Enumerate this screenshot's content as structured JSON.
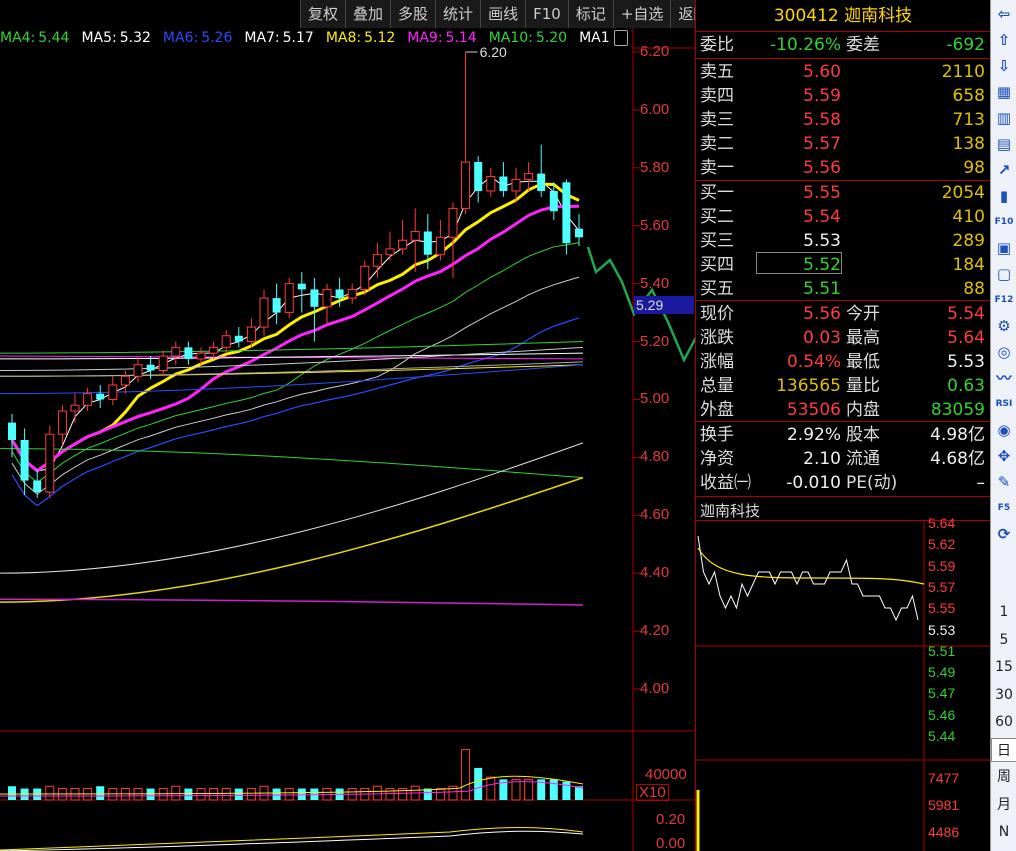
{
  "toolbar": {
    "buttons": [
      "复权",
      "叠加",
      "多股",
      "统计",
      "画线",
      "F10",
      "标记",
      "+自选",
      "返回"
    ]
  },
  "ma_legend": [
    {
      "label": "MA4:",
      "value": "5.44",
      "color": "#33d433"
    },
    {
      "label": "MA5:",
      "value": "5.32",
      "color": "#ffffff"
    },
    {
      "label": "MA6:",
      "value": "5.26",
      "color": "#2a4cff"
    },
    {
      "label": "MA7:",
      "value": "5.17",
      "color": "#ffffff"
    },
    {
      "label": "MA8:",
      "value": "5.12",
      "color": "#ffee00"
    },
    {
      "label": "MA9:",
      "value": "5.14",
      "color": "#ff22ff"
    },
    {
      "label": "MA10:",
      "value": "5.20",
      "color": "#33d433"
    },
    {
      "label": "MA1",
      "value": "",
      "color": "#ffffff"
    }
  ],
  "chart_data": {
    "type": "candlestick",
    "y_ticks": [
      "6.20",
      "6.00",
      "5.80",
      "5.60",
      "5.40",
      "5.20",
      "5.00",
      "4.80",
      "4.60",
      "4.40",
      "4.20",
      "4.00"
    ],
    "y_range": [
      3.95,
      6.25
    ],
    "high_marker": "6.20",
    "price_tag": "5.29",
    "volume_ticks": [
      "40000",
      "X10"
    ],
    "indicator_ticks": [
      "0.20",
      "0.00"
    ],
    "candles": [
      {
        "o": 4.92,
        "c": 4.86,
        "h": 4.95,
        "l": 4.8
      },
      {
        "o": 4.86,
        "c": 4.72,
        "h": 4.9,
        "l": 4.67
      },
      {
        "o": 4.72,
        "c": 4.68,
        "h": 4.76,
        "l": 4.66
      },
      {
        "o": 4.68,
        "c": 4.88,
        "h": 4.91,
        "l": 4.66
      },
      {
        "o": 4.88,
        "c": 4.96,
        "h": 4.98,
        "l": 4.84
      },
      {
        "o": 4.96,
        "c": 4.98,
        "h": 5.02,
        "l": 4.92
      },
      {
        "o": 4.98,
        "c": 5.02,
        "h": 5.04,
        "l": 4.96
      },
      {
        "o": 5.02,
        "c": 5.0,
        "h": 5.05,
        "l": 4.97
      },
      {
        "o": 5.0,
        "c": 5.05,
        "h": 5.08,
        "l": 4.98
      },
      {
        "o": 5.05,
        "c": 5.08,
        "h": 5.1,
        "l": 5.02
      },
      {
        "o": 5.08,
        "c": 5.12,
        "h": 5.15,
        "l": 5.06
      },
      {
        "o": 5.12,
        "c": 5.1,
        "h": 5.15,
        "l": 5.07
      },
      {
        "o": 5.1,
        "c": 5.15,
        "h": 5.17,
        "l": 5.08
      },
      {
        "o": 5.15,
        "c": 5.18,
        "h": 5.2,
        "l": 5.12
      },
      {
        "o": 5.18,
        "c": 5.14,
        "h": 5.2,
        "l": 5.12
      },
      {
        "o": 5.14,
        "c": 5.16,
        "h": 5.18,
        "l": 5.12
      },
      {
        "o": 5.16,
        "c": 5.18,
        "h": 5.2,
        "l": 5.14
      },
      {
        "o": 5.18,
        "c": 5.22,
        "h": 5.24,
        "l": 5.16
      },
      {
        "o": 5.22,
        "c": 5.2,
        "h": 5.25,
        "l": 5.18
      },
      {
        "o": 5.2,
        "c": 5.25,
        "h": 5.28,
        "l": 5.18
      },
      {
        "o": 5.25,
        "c": 5.35,
        "h": 5.38,
        "l": 5.22
      },
      {
        "o": 5.35,
        "c": 5.3,
        "h": 5.4,
        "l": 5.26
      },
      {
        "o": 5.3,
        "c": 5.4,
        "h": 5.42,
        "l": 5.28
      },
      {
        "o": 5.4,
        "c": 5.38,
        "h": 5.44,
        "l": 5.3
      },
      {
        "o": 5.38,
        "c": 5.32,
        "h": 5.42,
        "l": 5.2
      },
      {
        "o": 5.32,
        "c": 5.38,
        "h": 5.4,
        "l": 5.26
      },
      {
        "o": 5.38,
        "c": 5.35,
        "h": 5.42,
        "l": 5.32
      },
      {
        "o": 5.35,
        "c": 5.38,
        "h": 5.4,
        "l": 5.33
      },
      {
        "o": 5.38,
        "c": 5.46,
        "h": 5.48,
        "l": 5.36
      },
      {
        "o": 5.46,
        "c": 5.5,
        "h": 5.54,
        "l": 5.42
      },
      {
        "o": 5.5,
        "c": 5.52,
        "h": 5.58,
        "l": 5.48
      },
      {
        "o": 5.52,
        "c": 5.55,
        "h": 5.62,
        "l": 5.5
      },
      {
        "o": 5.55,
        "c": 5.58,
        "h": 5.66,
        "l": 5.44
      },
      {
        "o": 5.58,
        "c": 5.5,
        "h": 5.64,
        "l": 5.45
      },
      {
        "o": 5.5,
        "c": 5.56,
        "h": 5.62,
        "l": 5.48
      },
      {
        "o": 5.56,
        "c": 5.66,
        "h": 5.68,
        "l": 5.42
      },
      {
        "o": 5.66,
        "c": 5.82,
        "h": 6.2,
        "l": 5.64
      },
      {
        "o": 5.82,
        "c": 5.72,
        "h": 5.84,
        "l": 5.68
      },
      {
        "o": 5.72,
        "c": 5.77,
        "h": 5.8,
        "l": 5.7
      },
      {
        "o": 5.77,
        "c": 5.72,
        "h": 5.82,
        "l": 5.7
      },
      {
        "o": 5.72,
        "c": 5.76,
        "h": 5.8,
        "l": 5.68
      },
      {
        "o": 5.76,
        "c": 5.78,
        "h": 5.82,
        "l": 5.72
      },
      {
        "o": 5.78,
        "c": 5.72,
        "h": 5.88,
        "l": 5.7
      },
      {
        "o": 5.72,
        "c": 5.65,
        "h": 5.75,
        "l": 5.62
      },
      {
        "o": 5.75,
        "c": 5.54,
        "h": 5.76,
        "l": 5.5
      },
      {
        "o": 5.59,
        "c": 5.56,
        "h": 5.64,
        "l": 5.53
      }
    ],
    "volumes": [
      6,
      5,
      5,
      6,
      5,
      5,
      5,
      6,
      5,
      5,
      5,
      5,
      5,
      6,
      5,
      5,
      5,
      5,
      5,
      5,
      6,
      5,
      5,
      5,
      5,
      5,
      5,
      5,
      5,
      6,
      5,
      5,
      6,
      5,
      5,
      6,
      22,
      14,
      10,
      9,
      9,
      9,
      9,
      9,
      8,
      6
    ]
  },
  "quote": {
    "code": "300412",
    "name": "迦南科技",
    "weibi_label": "委比",
    "weibi": "-10.26%",
    "weicha_label": "委差",
    "weicha": "-692",
    "asks": [
      {
        "label": "卖五",
        "price": "5.60",
        "vol": "2110"
      },
      {
        "label": "卖四",
        "price": "5.59",
        "vol": "658"
      },
      {
        "label": "卖三",
        "price": "5.58",
        "vol": "713"
      },
      {
        "label": "卖二",
        "price": "5.57",
        "vol": "138"
      },
      {
        "label": "卖一",
        "price": "5.56",
        "vol": "98"
      }
    ],
    "bids": [
      {
        "label": "买一",
        "price": "5.55",
        "vol": "2054"
      },
      {
        "label": "买二",
        "price": "5.54",
        "vol": "410"
      },
      {
        "label": "买三",
        "price": "5.53",
        "vol": "289"
      },
      {
        "label": "买四",
        "price": "5.52",
        "vol": "184"
      },
      {
        "label": "买五",
        "price": "5.51",
        "vol": "88"
      }
    ],
    "stats": [
      {
        "l1": "现价",
        "v1": "5.56",
        "l2": "今开",
        "v2": "5.54"
      },
      {
        "l1": "涨跌",
        "v1": "0.03",
        "l2": "最高",
        "v2": "5.64"
      },
      {
        "l1": "涨幅",
        "v1": "0.54%",
        "l2": "最低",
        "v2": "5.53"
      },
      {
        "l1": "总量",
        "v1": "136565",
        "l2": "量比",
        "v2": "0.63"
      },
      {
        "l1": "外盘",
        "v1": "53506",
        "l2": "内盘",
        "v2": "83059"
      }
    ],
    "fin": [
      {
        "l1": "换手",
        "v1": "2.92%",
        "l2": "股本",
        "v2": "4.98亿"
      },
      {
        "l1": "净资",
        "v1": "2.10",
        "l2": "流通",
        "v2": "4.68亿"
      },
      {
        "l1": "收益㈠",
        "v1": "-0.010",
        "l2": "PE(动)",
        "v2": "–"
      }
    ]
  },
  "mini": {
    "title": "迦南科技",
    "price_labels": [
      "5.64",
      "5.62",
      "5.59",
      "5.57",
      "5.55",
      "5.53",
      "5.51",
      "5.49",
      "5.47",
      "5.46",
      "5.44"
    ],
    "vol_labels": [
      "7477",
      "5981",
      "4486"
    ]
  },
  "rbar": {
    "icons": [
      "arrow-left-icon",
      "arrow-up-icon",
      "arrow-down-icon",
      "grid-icon",
      "bars-icon",
      "chart-icon",
      "trend-icon",
      "candle-icon",
      "f10-icon",
      "doc-icon",
      "bookmark-icon",
      "f12-icon",
      "tool-icon",
      "refresh-icon",
      "wave-icon",
      "rsi-icon",
      "target-icon",
      "move-icon",
      "pen-icon",
      "f5-icon",
      "sync-icon"
    ],
    "icon_text": [
      "⇦",
      "⇧",
      "⇩",
      "▦",
      "▥",
      "▤",
      "↗",
      "▮",
      "F10",
      "▣",
      "▢",
      "F12",
      "⚙",
      "◎",
      "〰",
      "RSI",
      "◉",
      "✥",
      "✎",
      "F5",
      "⟳"
    ],
    "periods": [
      "1",
      "5",
      "15",
      "30",
      "60",
      "日",
      "周",
      "月",
      "N"
    ]
  }
}
